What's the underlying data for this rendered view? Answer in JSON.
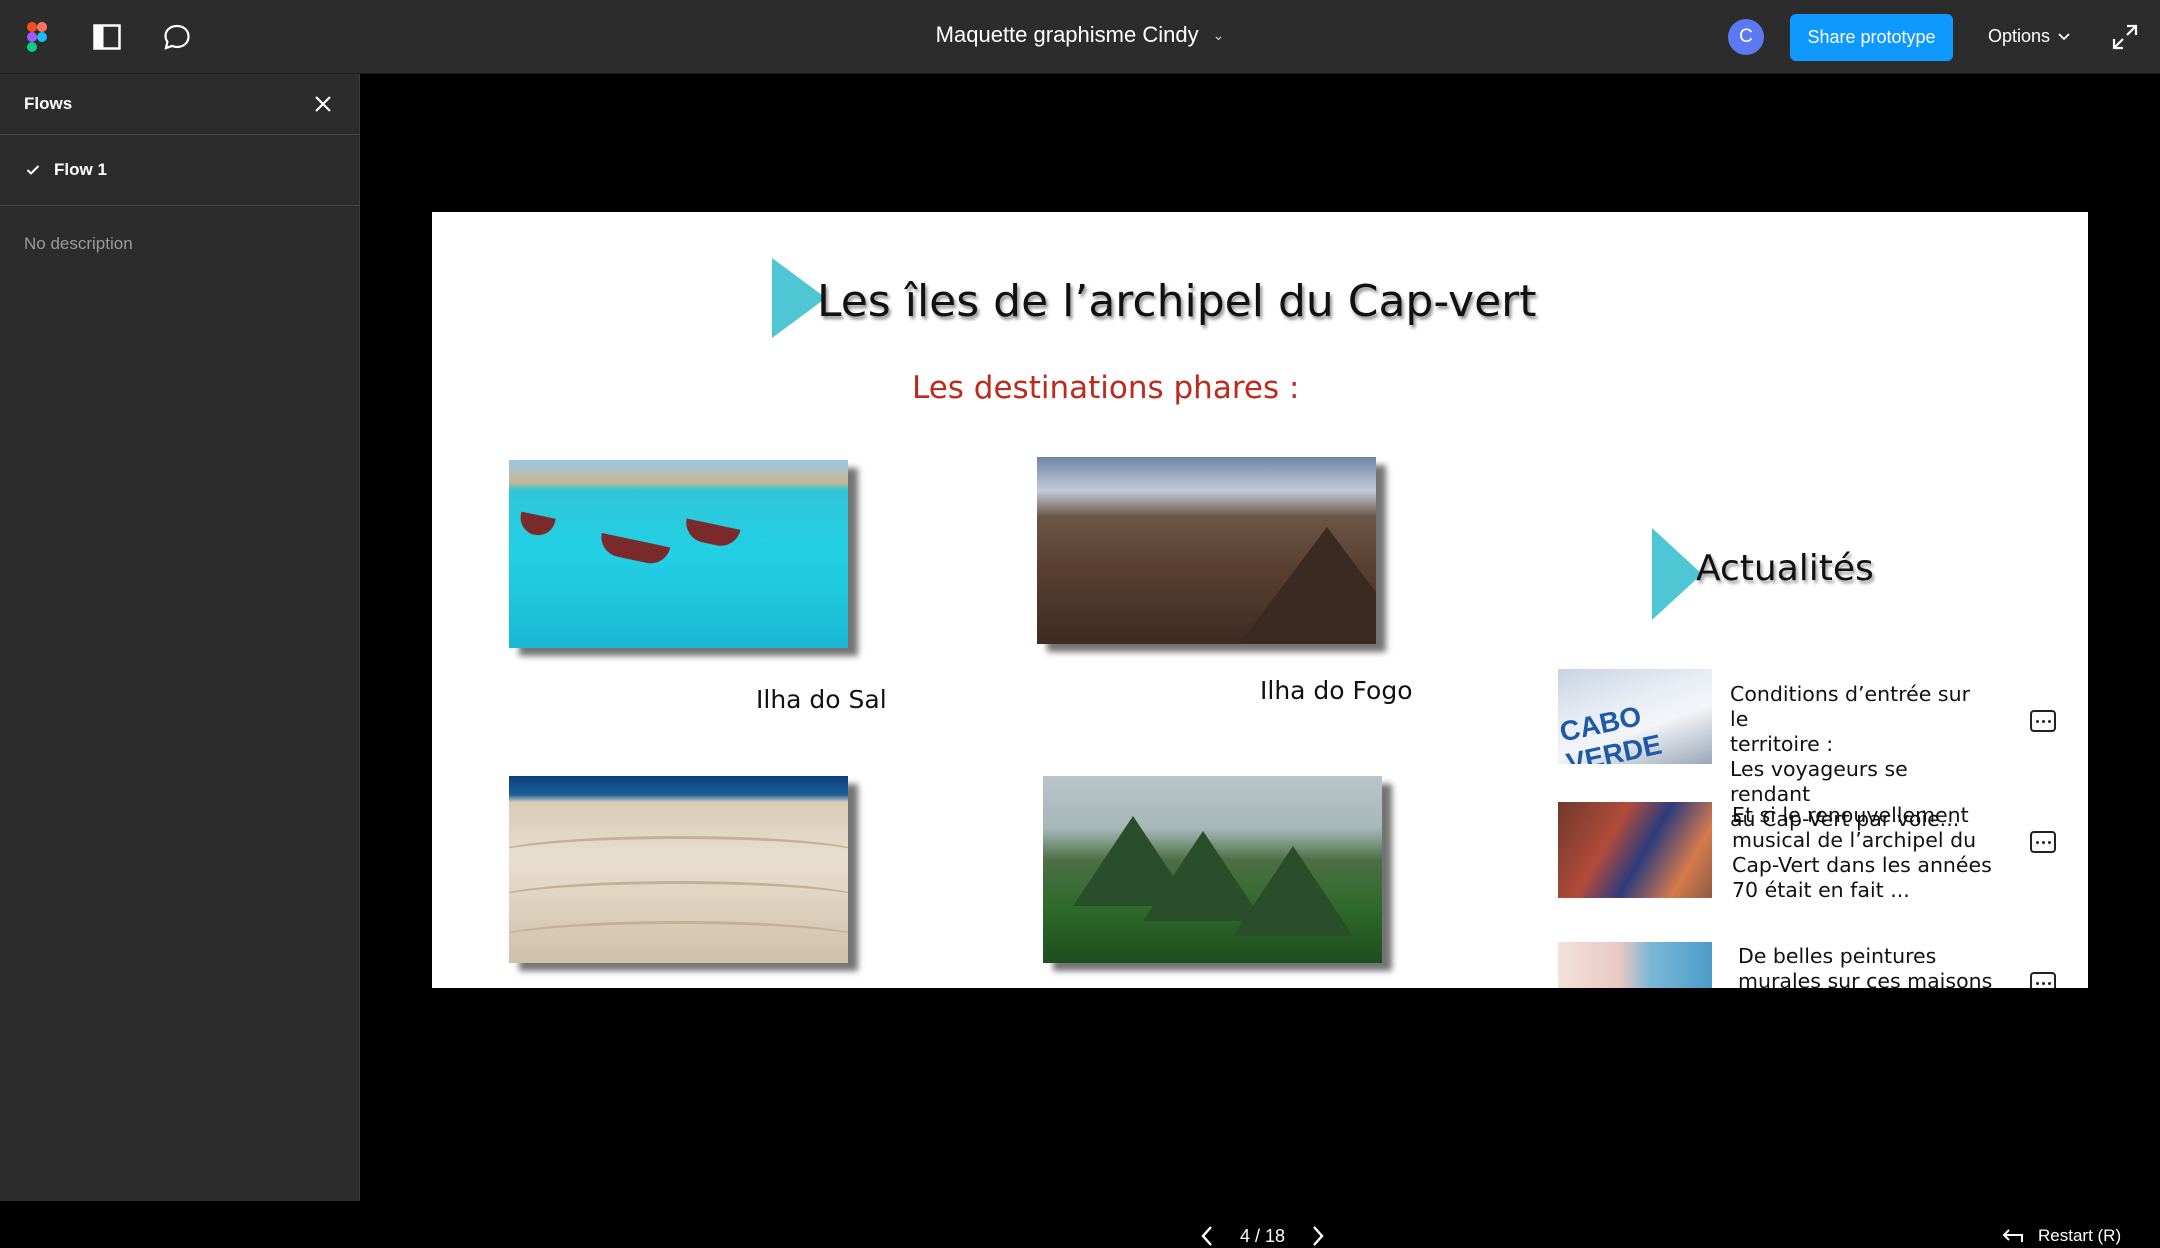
{
  "topbar": {
    "title": "Maquette graphisme Cindy",
    "avatar_letter": "C",
    "share_label": "Share prototype",
    "options_label": "Options",
    "icons": [
      "figma-logo-icon",
      "panel-icon",
      "comment-icon",
      "chevron-down-icon",
      "expand-icon"
    ],
    "colors": {
      "bar": "#2c2c2c",
      "share": "#0d99ff",
      "avatar": "#5b79f3"
    }
  },
  "sidebar": {
    "heading": "Flows",
    "flows": [
      {
        "label": "Flow 1",
        "selected": true
      }
    ],
    "description": "No description"
  },
  "slide": {
    "title": "Les îles de l’archipel du Cap-vert",
    "subtitle": "Les destinations phares :",
    "captions": {
      "sal": "Ilha do Sal",
      "fogo": "Ilha do Fogo"
    },
    "news_heading": "Actualités",
    "thumb_text": "CABO VERDE",
    "news": [
      {
        "line1": "Conditions d’entrée sur le",
        "line2": "territoire :",
        "line3": "Les voyageurs se rendant",
        "line4": "au Cap-Vert par voie..."
      },
      {
        "line1": "Et si le renouvellement",
        "line2": "musical de l’archipel du",
        "line3": "Cap-Vert dans les années",
        "line4": "70 était en fait ..."
      },
      {
        "line1": "De belles peintures",
        "line2": "murales sur ces maisons",
        "line3": "",
        "line4": ""
      }
    ],
    "colors": {
      "accent_triangle": "#4fc6d3",
      "subtitle": "#c0291d"
    }
  },
  "footer": {
    "page_indicator": "4 / 18",
    "restart_label": "Restart (R)"
  }
}
